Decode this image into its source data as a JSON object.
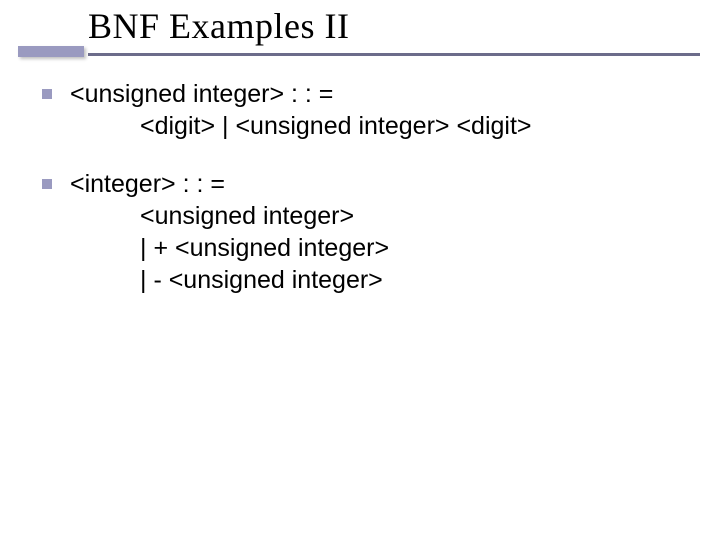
{
  "title": "BNF Examples II",
  "bullets": [
    {
      "head": "<unsigned integer> : : =",
      "lines": [
        "<digit> | <unsigned integer> <digit>"
      ]
    },
    {
      "head": "<integer> : : =",
      "lines": [
        "<unsigned integer>",
        "| + <unsigned integer>",
        "| - <unsigned integer>"
      ]
    }
  ]
}
